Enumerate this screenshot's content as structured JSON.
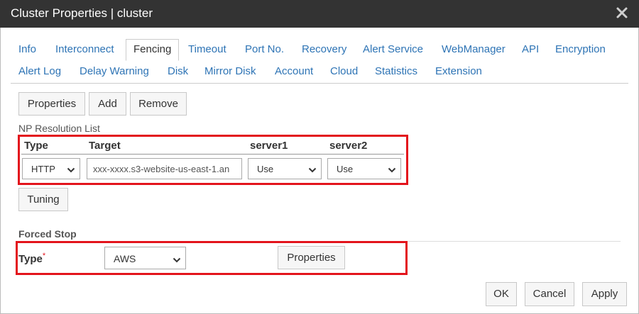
{
  "window": {
    "title": "Cluster Properties | cluster"
  },
  "tabs": [
    {
      "id": "info",
      "label": "Info"
    },
    {
      "id": "interconnect",
      "label": "Interconnect"
    },
    {
      "id": "fencing",
      "label": "Fencing",
      "active": true
    },
    {
      "id": "timeout",
      "label": "Timeout"
    },
    {
      "id": "port-no",
      "label": "Port No."
    },
    {
      "id": "recovery",
      "label": "Recovery"
    },
    {
      "id": "alert-service",
      "label": "Alert Service"
    },
    {
      "id": "webmanager",
      "label": "WebManager"
    },
    {
      "id": "api",
      "label": "API"
    },
    {
      "id": "encryption",
      "label": "Encryption"
    },
    {
      "id": "alert-log",
      "label": "Alert Log"
    },
    {
      "id": "delay-warning",
      "label": "Delay Warning"
    },
    {
      "id": "disk",
      "label": "Disk"
    },
    {
      "id": "mirror-disk",
      "label": "Mirror Disk"
    },
    {
      "id": "account",
      "label": "Account"
    },
    {
      "id": "cloud",
      "label": "Cloud"
    },
    {
      "id": "statistics",
      "label": "Statistics"
    },
    {
      "id": "extension",
      "label": "Extension"
    }
  ],
  "toolbar": {
    "properties_label": "Properties",
    "add_label": "Add",
    "remove_label": "Remove"
  },
  "np_resolution": {
    "section_label": "NP Resolution List",
    "columns": {
      "type": "Type",
      "target": "Target",
      "server1": "server1",
      "server2": "server2"
    },
    "row": {
      "type": "HTTP",
      "target": "xxx-xxxx.s3-website-us-east-1.an",
      "server1": "Use",
      "server2": "Use"
    },
    "tuning_label": "Tuning"
  },
  "forced_stop": {
    "section_label": "Forced Stop",
    "type_label": "Type",
    "required_mark": "*",
    "type_value": "AWS",
    "properties_label": "Properties"
  },
  "footer": {
    "ok_label": "OK",
    "cancel_label": "Cancel",
    "apply_label": "Apply"
  },
  "colors": {
    "titlebar": "#333333",
    "link": "#2e74b5",
    "highlight": "#e3141c",
    "required": "#e3141c"
  }
}
